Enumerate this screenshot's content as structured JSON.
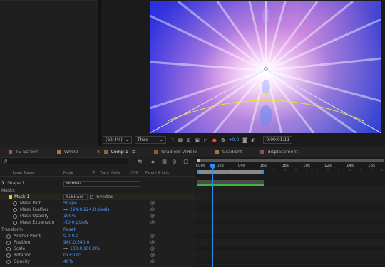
{
  "viewer": {
    "zoom": "(62.4%)",
    "resolution": "Third",
    "exposure": "+0.0",
    "timecode": "0:00:01:11"
  },
  "tabs": [
    {
      "label": "TV Screen",
      "color": "#a05a3a"
    },
    {
      "label": "Whole",
      "color": "#a07a3a"
    },
    {
      "label": "Comp 1",
      "color": "#8a6a3a",
      "active": true,
      "menu": "≡"
    },
    {
      "label": "Gradient WHole",
      "color": "#8a5f3a"
    },
    {
      "label": "Gradient",
      "color": "#a0783a"
    },
    {
      "label": "displacement",
      "color": "#8a4a6a"
    }
  ],
  "timeline": {
    "search_placeholder": "ρ.",
    "columns": {
      "layer_name": "Layer Name",
      "mode": "Mode",
      "t": "T",
      "track_matte": "Track Matte",
      "parent": "Parent & Link"
    },
    "layer": {
      "number": "1",
      "name": "Shape 1",
      "mode": "Normal"
    },
    "masks_label": "Masks",
    "mask": {
      "name": "Mask 1",
      "mode": "Subtract",
      "inverted": "Inverted"
    },
    "mask_props": [
      {
        "label": "Mask Path",
        "value": "Shape..."
      },
      {
        "label": "Mask Feather",
        "value": "224.0,224.0 pixels"
      },
      {
        "label": "Mask Opacity",
        "value": "100%"
      },
      {
        "label": "Mask Expansion",
        "value": "-50.0 pixels"
      }
    ],
    "transform": {
      "label": "Transform",
      "reset": "Reset"
    },
    "transform_props": [
      {
        "label": "Anchor Point",
        "value": "0.0,0.0"
      },
      {
        "label": "Position",
        "value": "960.0,540.0"
      },
      {
        "label": "Scale",
        "value": "100.0,100.0%"
      },
      {
        "label": "Rotation",
        "value": "0x+0.0°"
      },
      {
        "label": "Opacity",
        "value": "40%"
      }
    ],
    "ruler": [
      "):00s",
      "02s",
      "04s",
      "06s",
      "08s",
      "10s",
      "12s",
      "14s",
      "16s"
    ],
    "current_time_seconds": 1.46
  },
  "colors": {
    "accent": "#2d8cf0",
    "value_blue": "#4a9bff",
    "track_green": "#3fb33f"
  }
}
